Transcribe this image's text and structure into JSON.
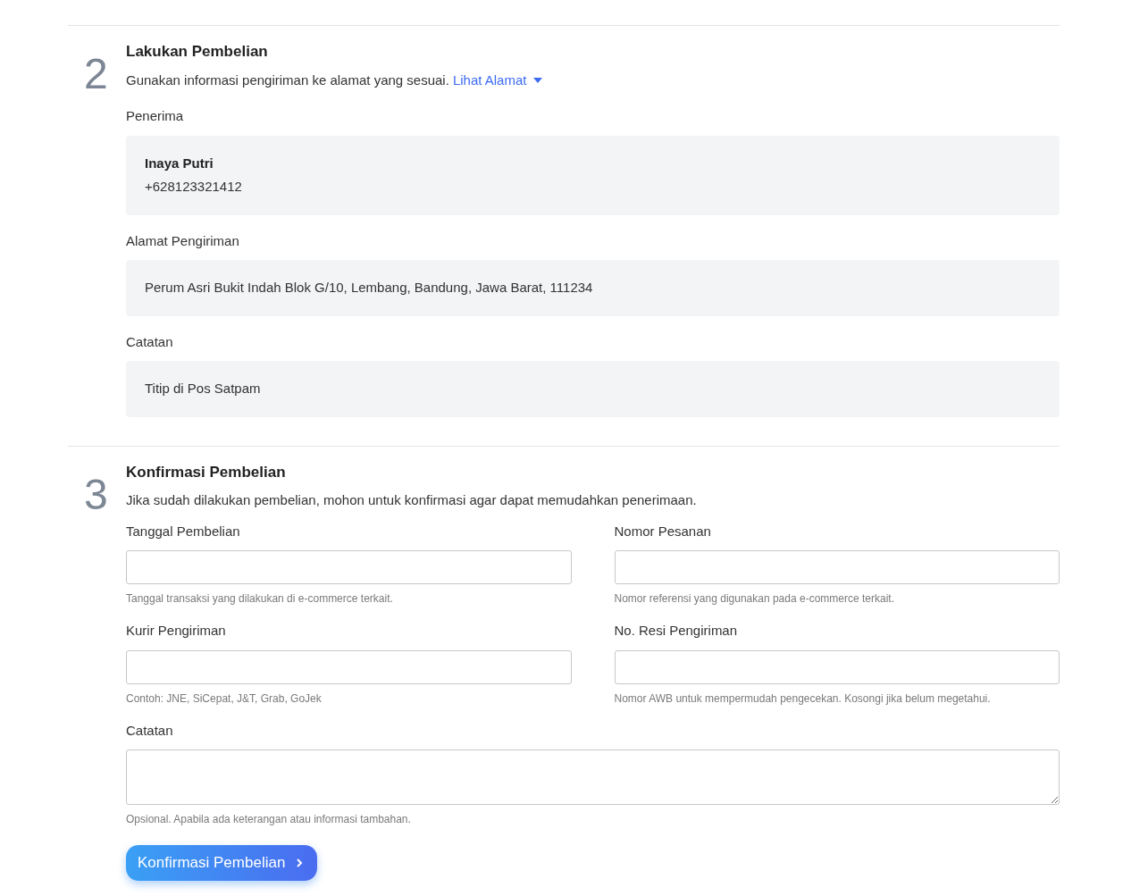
{
  "steps": [
    {
      "number": "2",
      "title": "Lakukan Pembelian",
      "description": "Gunakan informasi pengiriman ke alamat yang sesuai.",
      "link": "Lihat Alamat",
      "info": [
        {
          "label": "Penerima",
          "lines": [
            {
              "text": "Inaya Putri",
              "bold": true
            },
            {
              "text": "+628123321412",
              "bold": false
            }
          ]
        },
        {
          "label": "Alamat Pengiriman",
          "lines": [
            {
              "text": "Perum Asri Bukit Indah Blok G/10, Lembang, Bandung, Jawa Barat, 111234",
              "bold": false
            }
          ]
        },
        {
          "label": "Catatan",
          "lines": [
            {
              "text": "Titip di Pos Satpam",
              "bold": false
            }
          ]
        }
      ]
    },
    {
      "number": "3",
      "title": "Konfirmasi Pembelian",
      "description": "Jika sudah dilakukan pembelian, mohon untuk konfirmasi agar dapat memudahkan penerimaan.",
      "fields": [
        {
          "kind": "input",
          "label": "Tanggal Pembelian",
          "help": "Tanggal transaksi yang dilakukan di e-commerce terkait."
        },
        {
          "kind": "input",
          "label": "Nomor Pesanan",
          "help": "Nomor referensi yang digunakan pada e-commerce terkait."
        },
        {
          "kind": "input",
          "label": "Kurir Pengiriman",
          "help": "Contoh: JNE, SiCepat, J&T, Grab, GoJek"
        },
        {
          "kind": "input",
          "label": "No. Resi Pengiriman",
          "help": "Nomor AWB untuk mempermudah pengecekan. Kosongi jika belum megetahui."
        },
        {
          "kind": "textarea",
          "label": "Catatan",
          "help": "Opsional. Apabila ada keterangan atau informasi tambahan."
        }
      ],
      "button": "Konfirmasi Pembelian"
    }
  ]
}
